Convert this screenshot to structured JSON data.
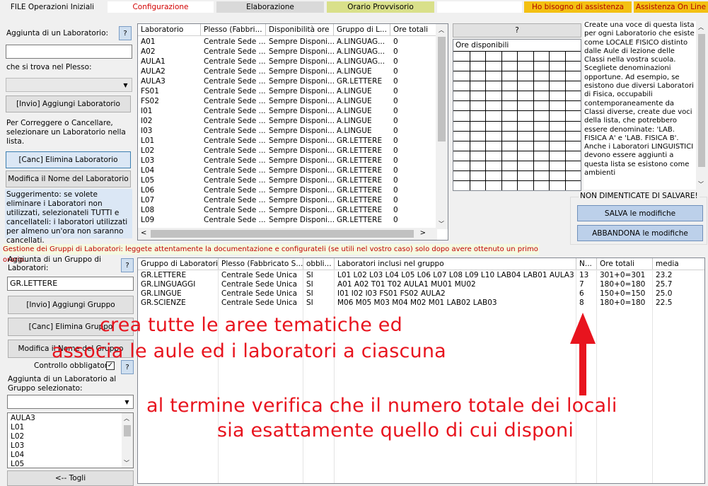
{
  "tabs": [
    {
      "label": "FILE Operazioni Iniziali"
    },
    {
      "label": "Configurazione"
    },
    {
      "label": "Elaborazione"
    },
    {
      "label": "Orario Provvisorio"
    },
    {
      "label": "Ho bisogno di assistenza"
    },
    {
      "label": "Assistenza On Line"
    }
  ],
  "lab_panel": {
    "add_label": "Aggiunta di un Laboratorio:",
    "help": "?",
    "plesso_label": "che si trova nel Plesso:",
    "add_button": "[Invio] Aggiungi Laboratorio",
    "edit_hint": "Per Correggere o Cancellare, selezionare un Laboratorio nella lista.",
    "delete_button": "[Canc] Elimina Laboratorio",
    "rename_button": "Modifica il Nome del Laboratorio",
    "suggestion": "Suggerimento: se volete eliminare i Laboratori non utilizzati, selezionateli TUTTI e cancellateli: i laboratori utilizzati per almeno un'ora non saranno cancellati."
  },
  "lab_table": {
    "columns": [
      "Laboratorio",
      "Plesso (Fabbri...",
      "Disponibilità ore",
      "Gruppo di L...",
      "Ore totali"
    ],
    "rows": [
      [
        "A01",
        "Centrale Sede ...",
        "Sempre Disponi...",
        "A.LINGUAG...",
        "0"
      ],
      [
        "A02",
        "Centrale Sede ...",
        "Sempre Disponi...",
        "A.LINGUAG...",
        "0"
      ],
      [
        "AULA1",
        "Centrale Sede ...",
        "Sempre Disponi...",
        "A.LINGUAG...",
        "0"
      ],
      [
        "AULA2",
        "Centrale Sede ...",
        "Sempre Disponi...",
        "A.LINGUE",
        "0"
      ],
      [
        "AULA3",
        "Centrale Sede ...",
        "Sempre Disponi...",
        "GR.LETTERE",
        "0"
      ],
      [
        "FS01",
        "Centrale Sede ...",
        "Sempre Disponi...",
        "A.LINGUE",
        "0"
      ],
      [
        "FS02",
        "Centrale Sede ...",
        "Sempre Disponi...",
        "A.LINGUE",
        "0"
      ],
      [
        "I01",
        "Centrale Sede ...",
        "Sempre Disponi...",
        "A.LINGUE",
        "0"
      ],
      [
        "I02",
        "Centrale Sede ...",
        "Sempre Disponi...",
        "A.LINGUE",
        "0"
      ],
      [
        "I03",
        "Centrale Sede ...",
        "Sempre Disponi...",
        "A.LINGUE",
        "0"
      ],
      [
        "L01",
        "Centrale Sede ...",
        "Sempre Disponi...",
        "GR.LETTERE",
        "0"
      ],
      [
        "L02",
        "Centrale Sede ...",
        "Sempre Disponi...",
        "GR.LETTERE",
        "0"
      ],
      [
        "L03",
        "Centrale Sede ...",
        "Sempre Disponi...",
        "GR.LETTERE",
        "0"
      ],
      [
        "L04",
        "Centrale Sede ...",
        "Sempre Disponi...",
        "GR.LETTERE",
        "0"
      ],
      [
        "L05",
        "Centrale Sede ...",
        "Sempre Disponi...",
        "GR.LETTERE",
        "0"
      ],
      [
        "L06",
        "Centrale Sede ...",
        "Sempre Disponi...",
        "GR.LETTERE",
        "0"
      ],
      [
        "L07",
        "Centrale Sede ...",
        "Sempre Disponi...",
        "GR.LETTERE",
        "0"
      ],
      [
        "L08",
        "Centrale Sede ...",
        "Sempre Disponi...",
        "GR.LETTERE",
        "0"
      ],
      [
        "L09",
        "Centrale Sede ...",
        "Sempre Disponi...",
        "GR.LETTERE",
        "0"
      ]
    ]
  },
  "availability": {
    "help": "?",
    "title": "Ore disponibili"
  },
  "info_text": "Create una voce di questa lista per ogni Laboratorio che esiste come LOCALE FISICO distinto dalle Aule di lezione delle Classi nella vostra scuola. Scegliete denominazioni opportune. Ad esempio, se esistono due diversi Laboratori di Fisica, occupabili contemporaneamente da Classi diverse, create due voci della lista, che potrebbero essere denominate: 'LAB. FISICA A' e 'LAB. FISICA B'. Anche i Laboratori LINGUISTICI devono essere aggiunti a questa lista se esistono come ambienti",
  "save_box": {
    "title": "NON DIMENTICATE DI SALVARE!",
    "save_button": "SALVA le modifiche",
    "discard_button": "ABBANDONA le modifiche"
  },
  "groups_banner": "Gestione dei Gruppi di Laboratori: leggete attentamente la documentazione e configurateli (se utili nel vostro caso) solo dopo avere ottenuto un primo orario.",
  "group_panel": {
    "add_label": "Aggiunta di un Gruppo di Laboratori:",
    "help": "?",
    "name_value": "GR.LETTERE",
    "add_button": "[Invio] Aggiungi Gruppo",
    "delete_button": "[Canc] Elimina Gruppo",
    "rename_button": "Modifica il Nome del Gruppo",
    "mandatory_label": "Controllo obbligatorio",
    "mandatory_checked": "✓",
    "add_lab_label": "Aggiunta di un Laboratorio al Gruppo selezionato:",
    "list_items": [
      "AULA3",
      "L01",
      "L02",
      "L03",
      "L04",
      "L05"
    ],
    "remove_button": "<-- Togli"
  },
  "group_table": {
    "columns": [
      "Gruppo di Laboratori",
      "Plesso (Fabbricato S...",
      "obbli...",
      "Laboratori inclusi nel gruppo",
      "N...",
      "Ore totali",
      "media"
    ],
    "rows": [
      [
        "GR.LETTERE",
        "Centrale Sede Unica",
        "SI",
        "L01 L02 L03 L04 L05 L06 L07 L08 L09 L10 LAB04 LAB01 AULA3",
        "13",
        "301+0=301",
        "23.2"
      ],
      [
        "GR.LINGUAGGI",
        "Centrale Sede Unica",
        "SI",
        "A01 A02 T01 T02 AULA1 MU01 MU02",
        "7",
        "180+0=180",
        "25.7"
      ],
      [
        "GR.LINGUE",
        "Centrale Sede Unica",
        "SI",
        "I01 I02 I03 FS01 FS02 AULA2",
        "6",
        "150+0=150",
        "25.0"
      ],
      [
        "GR.SCIENZE",
        "Centrale Sede Unica",
        "SI",
        "M06 M05 M03 M04 M02 M01 LAB02 LAB03",
        "8",
        "180+0=180",
        "22.5"
      ]
    ]
  },
  "annotations": {
    "line1": "crea tutte le aree tematiche ed",
    "line2": "associa le aule ed i laboratori a ciascuna",
    "line3": "al termine verifica che il numero totale dei locali",
    "line4": "sia esattamente quello di cui disponi",
    "color": "#e8141e"
  }
}
